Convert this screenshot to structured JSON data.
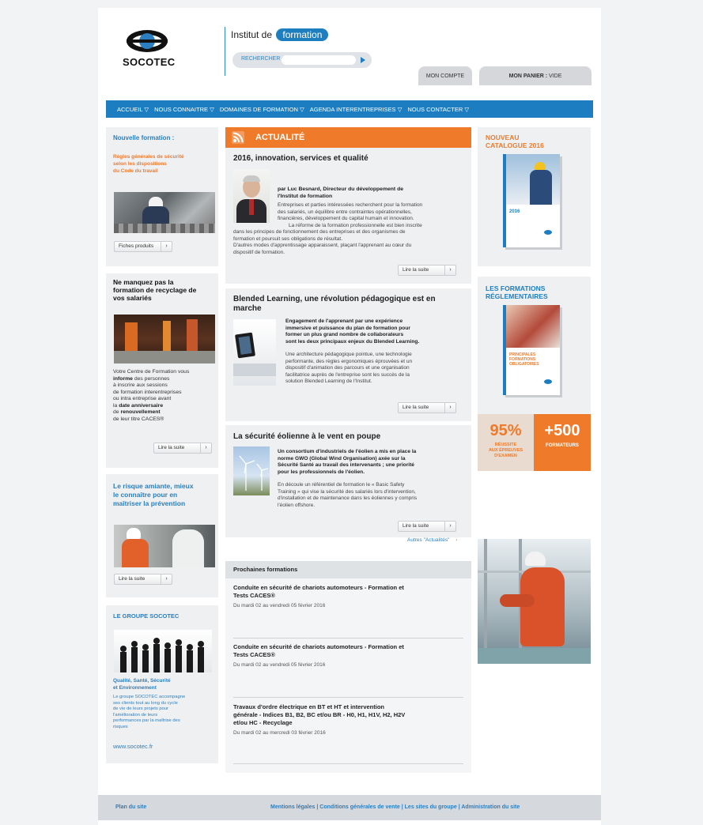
{
  "header": {
    "logo_text": "SOCOTEC",
    "institut_label": "Institut de",
    "institut_pill": "formation",
    "search_label": "RECHERCHER :",
    "search_value": "",
    "account_tab": "MON COMPTE",
    "cart_label": "MON PANIER :",
    "cart_value": "VIDE"
  },
  "nav": [
    "ACCUEIL ▽",
    "NOUS CONNAITRE ▽",
    "DOMAINES DE FORMATION ▽",
    "AGENDA INTERENTREPRISES ▽",
    "NOUS CONTACTER ▽"
  ],
  "left": {
    "box1": {
      "title": "Nouvelle formation :",
      "subtitle_lines": [
        "Règles générales de sécurité",
        "selon les dispositions",
        "du Code du travail"
      ],
      "button": "Fiches produits"
    },
    "box2": {
      "title_lines": [
        "Ne manquez pas la",
        "formation de recyclage de",
        "vos salariés"
      ],
      "text1": "Votre Centre de Formation vous",
      "bold1": "informe",
      "text2": " des personnes",
      "text3": "à inscrire aux sessions",
      "text4": "de formation interentreprises",
      "text5": "ou intra entreprise avant",
      "text6": "la ",
      "bold2": "date anniversaire",
      "text7": "de ",
      "bold3": "renouvellement",
      "text8": "de leur titre CACES®",
      "button": "Lire la suite"
    },
    "box3": {
      "title_lines": [
        "Le risque amiante, mieux",
        "le connaître pour en",
        "maîtriser la prévention"
      ],
      "button": "Lire la suite"
    },
    "box4": {
      "title": "LE GROUPE SOCOTEC",
      "subtitle_lines": [
        "Qualité, Santé, Sécurité",
        "et Environnement"
      ],
      "text_lines": [
        "Le groupe SOCOTEC accompagne",
        "ses clients tout au long du cycle",
        "de vie de leurs projets pour",
        "l'amélioration de leurs",
        "performances par la maîtrise des",
        "risques"
      ],
      "link": "www.socotec.fr"
    }
  },
  "center": {
    "actu_header": "ACTUALITÉ",
    "article1": {
      "title": "2016, innovation, services et qualité",
      "author_lines": [
        "par Luc Besnard, Directeur du développement de",
        "l'Institut de formation"
      ],
      "body_lines_right": [
        "Entreprises et parties intéressées recherchent pour la formation",
        "des salariés, un équilibre entre contraintes opérationnelles,",
        "financières, développement du capital humain et innovation.",
        "La réforme de la formation professionnelle est bien inscrite"
      ],
      "body_lines_full": [
        "dans les principes de fonctionnement des entreprises et des organismes de",
        "formation et poursuit ses obligations de résultat.",
        "D'autres modes d'apprentissage apparaissent, plaçant l'apprenant au cœur du",
        "dispositif de formation."
      ],
      "button": "Lire la suite"
    },
    "article2": {
      "title_lines": [
        "Blended Learning, une révolution pédagogique est en",
        "marche"
      ],
      "lead_lines": [
        "Engagement de l'apprenant par une expérience",
        "immersive et puissance du plan de formation pour",
        "former un plus grand nombre de collaborateurs",
        "sont les deux principaux enjeux du Blended Learning."
      ],
      "body_lines": [
        "Une architecture pédagogique pointue, une technologie",
        "performante, des règles ergonomiques éprouvées et un",
        "dispositif d'animation des parcours et une organisation",
        "facilitatrice auprès de l'entreprise sont les succès de la",
        "solution Blended Learning de l'Institut."
      ],
      "button": "Lire la suite"
    },
    "article3": {
      "title": "La sécurité éolienne à le vent en poupe",
      "lead_lines": [
        "Un consortium d'industriels de l'éolien a mis en place la",
        "norme GWO (Global Wind Organisation) axée sur la",
        "Sécurité Santé au travail des intervenants ; une priorité",
        "pour les professionnels de l'éolien."
      ],
      "body_lines": [
        "En découle un référentiel de formation le « Basic Safety",
        "Training » qui vise la sécurité des salariés lors d'intervention,",
        "d'installation et  de maintenance dans les éoliennes y compris",
        "l'éolien offshore."
      ],
      "button": "Lire la suite"
    },
    "more_link": "Autres \"Actualités\"",
    "more_arrow": "›",
    "next_header": "Prochaines formations",
    "trainings": [
      {
        "title_lines": [
          "Conduite en sécurité de chariots automoteurs - Formation et",
          "Tests CACES®"
        ],
        "date": "Du mardi 02 au vendredi 05 février 2016"
      },
      {
        "title_lines": [
          "Conduite en sécurité de chariots automoteurs - Formation et",
          "Tests CACES®"
        ],
        "date": "Du mardi 02 au vendredi 05 février 2016"
      },
      {
        "title_lines": [
          "Travaux d'ordre électrique en BT et HT et intervention",
          "générale - Indices B1, B2, BC et/ou BR - H0, H1, H1V, H2, H2V",
          "et/ou HC - Recyclage"
        ],
        "date": "Du mardi 02 au mercredi 03 février 2016"
      }
    ]
  },
  "right": {
    "catalogue_lines": [
      "NOUVEAU",
      "CATALOGUE 2016"
    ],
    "reglementaires_lines": [
      "LES FORMATIONS",
      "RÉGLEMENTAIRES"
    ],
    "stat1_value": "95%",
    "stat1_lines": [
      "RÉUSSITE",
      "AUX ÉPREUVES",
      "D'EXAMEN"
    ],
    "stat2_value": "+500",
    "stat2_label": "FORMATEURS",
    "book1_cover_text": "2016",
    "book2_cover_lines": [
      "PRINCIPALES",
      "FORMATIONS",
      "OBLIGATOIRES"
    ]
  },
  "footer": {
    "plan": "Plan du site",
    "links": [
      "Mentions légales",
      "Conditions générales de vente",
      "Les sites du groupe",
      "Administration du site"
    ],
    "separator": " | "
  },
  "colors": {
    "brand_blue": "#1c7ec1",
    "brand_orange": "#ef7a2a",
    "panel_gray": "#eef0f2"
  }
}
